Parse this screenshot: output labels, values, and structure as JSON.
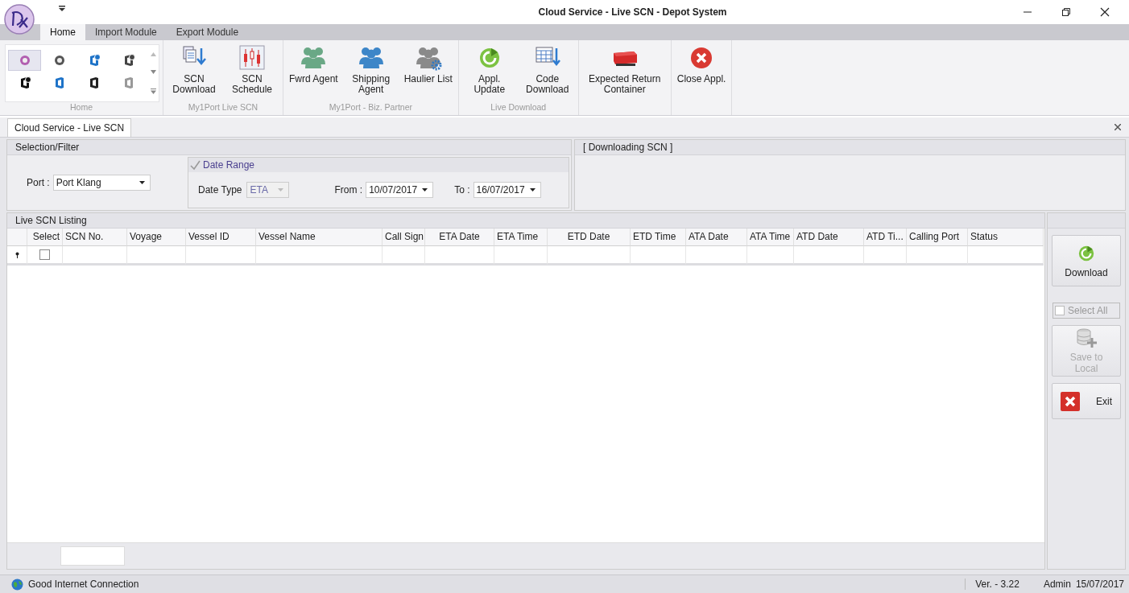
{
  "window": {
    "title": "Cloud Service - Live SCN - Depot System"
  },
  "ribbon": {
    "tabs": [
      {
        "label": "Home",
        "selected": true
      },
      {
        "label": "Import Module",
        "selected": false
      },
      {
        "label": "Export Module",
        "selected": false
      }
    ],
    "gallery": {
      "caption": "Home",
      "items": [
        {
          "kind": "round-pink",
          "selected": true
        },
        {
          "kind": "round-grey",
          "selected": false
        },
        {
          "kind": "office-blue-badge",
          "selected": false
        },
        {
          "kind": "office-grey-badge",
          "selected": false
        },
        {
          "kind": "office-black-badge",
          "selected": false
        },
        {
          "kind": "office-blue",
          "selected": false
        },
        {
          "kind": "office-black",
          "selected": false
        },
        {
          "kind": "office-grey",
          "selected": false
        }
      ]
    },
    "groups": [
      {
        "caption": "My1Port Live SCN",
        "buttons": [
          {
            "label": "SCN Download",
            "kind": "document-download"
          },
          {
            "label": "SCN Schedule",
            "kind": "candlestick"
          }
        ]
      },
      {
        "caption": "My1Port - Biz. Partner",
        "buttons": [
          {
            "label": "Fwrd Agent",
            "kind": "people-green"
          },
          {
            "label": "Shipping Agent",
            "kind": "people-blue"
          },
          {
            "label": "Haulier List",
            "kind": "people-gear"
          }
        ]
      },
      {
        "caption": "Live Download",
        "buttons": [
          {
            "label": "Appl. Update",
            "kind": "refresh"
          },
          {
            "label": "Code Download",
            "kind": "grid-download"
          }
        ]
      },
      {
        "buttons": [
          {
            "label": "Expected Return Container",
            "kind": "container"
          }
        ]
      },
      {
        "buttons": [
          {
            "label": "Close Appl.",
            "kind": "close-circle"
          }
        ]
      }
    ]
  },
  "document_tab": {
    "label": "Cloud Service - Live SCN",
    "selected": true
  },
  "filter": {
    "title": "Selection/Filter",
    "port_label": "Port :",
    "port_value": "Port Klang",
    "date_range": {
      "label": "Date Range",
      "checked": true,
      "date_type_label": "Date Type",
      "date_type_value": "ETA",
      "date_type_disabled": true,
      "from_label": "From :",
      "from_value": "10/07/2017",
      "to_label": "To :",
      "to_value": "16/07/2017"
    }
  },
  "downloading_panel": {
    "title": "[ Downloading SCN ]"
  },
  "listing": {
    "title": "Live SCN Listing",
    "select_checked": false,
    "columns": [
      "Select",
      "SCN No.",
      "Voyage",
      "Vessel ID",
      "Vessel Name",
      "Call Sign",
      "ETA Date",
      "ETA Time",
      "ETD Date",
      "ETD Time",
      "ATA Date",
      "ATA Time",
      "ATD Date",
      "ATD Ti...",
      "Calling Port",
      "Status"
    ]
  },
  "actions": [
    {
      "kind": "download",
      "label": "Download",
      "disabled": false
    },
    {
      "kind": "checkbox",
      "label": "Select All",
      "checked": false,
      "disabled": true
    },
    {
      "kind": "save",
      "label": "Save to Local",
      "disabled": true
    },
    {
      "kind": "exit",
      "label": "Exit",
      "disabled": false
    }
  ],
  "status_bar": {
    "connection": "Good Internet Connection",
    "version": "Ver. - 3.22",
    "user": "Admin",
    "date": "15/07/2017"
  }
}
